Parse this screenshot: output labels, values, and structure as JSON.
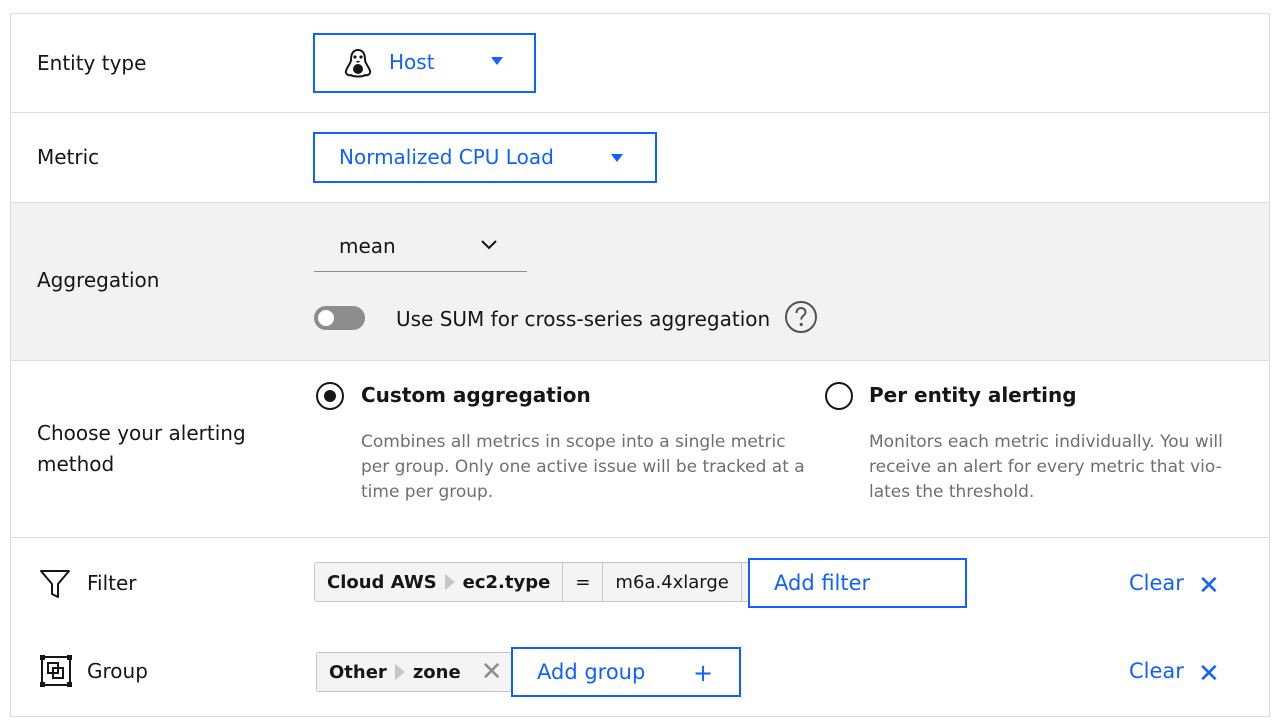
{
  "entity_type": {
    "label": "Entity type",
    "value": "Host",
    "icon": "linux-penguin-icon"
  },
  "metric": {
    "label": "Metric",
    "value": "Normalized CPU Load"
  },
  "aggregation": {
    "label": "Aggregation",
    "value": "mean",
    "toggle_label": "Use SUM for cross-series aggregation",
    "toggle_on": false
  },
  "alerting": {
    "label": "Choose your alerting method",
    "options": [
      {
        "title": "Custom aggregation",
        "desc": "Combines all metrics in scope into a single metric per group. Only one active issue will be tracked at a time per group.",
        "selected": true
      },
      {
        "title": "Per entity alerting",
        "desc": "Monitors each metric individually. You will receive an alert for every metric that vio-lates the threshold.",
        "selected": false
      }
    ]
  },
  "filter": {
    "label": "Filter",
    "tag": {
      "source": "Cloud AWS",
      "key": "ec2.type",
      "op": "=",
      "value": "m6a.4xlarge"
    },
    "add_label": "Add filter",
    "clear_label": "Clear"
  },
  "group": {
    "label": "Group",
    "tag": {
      "source": "Other",
      "key": "zone"
    },
    "add_label": "Add group",
    "clear_label": "Clear"
  },
  "colors": {
    "accent": "#0f62fe",
    "gray_bg": "#f2f2f2",
    "border": "#dcdcdc"
  }
}
